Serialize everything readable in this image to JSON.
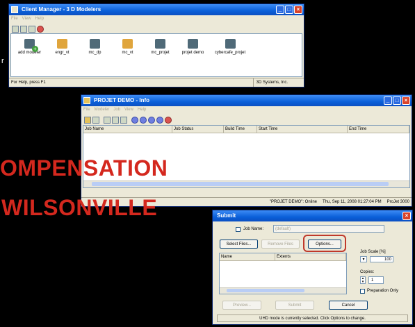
{
  "client_manager": {
    "title": "Client Manager - 3 D Modelers",
    "menu": [
      "File",
      "View",
      "Help"
    ],
    "icons": [
      "add modeler",
      "engr_vt",
      "mc_dp",
      "mc_vt",
      "mc_projet",
      "projet demo",
      "cybercafe_projet"
    ],
    "status_left": "For Help, press F1",
    "status_right": "3D Systems, Inc."
  },
  "projet_info": {
    "title": "PROJET DEMO - Info",
    "menu": [
      "File",
      "Modeler",
      "Job",
      "View",
      "Help"
    ],
    "columns": [
      "Job Name",
      "Job Status",
      "Build Time",
      "Start Time",
      "End Time"
    ],
    "status_left": "\"PROJET DEMO\": Online",
    "status_mid": "Thu, Sep 11, 2008  01:27:04 PM",
    "status_right": "ProJet 3000"
  },
  "overlay": {
    "line1": "OMPENSATION",
    "line2": "WILSONVILLE",
    "stray_left": "r",
    "stray_mid": "P"
  },
  "submit": {
    "title": "Submit",
    "job_name_label": "Job Name:",
    "job_name_value": "(default)",
    "select_files": "Select Files...",
    "remove_files": "Remove Files",
    "options": "Options...",
    "col_name": "Name",
    "col_extents": "Extents",
    "job_scale_label": "Job Scale [%]",
    "job_scale_value": "100",
    "copies_label": "Copies:",
    "copies_value": "1",
    "preparation_only": "Preparation Only",
    "preview": "Preview...",
    "submit_btn": "Submit",
    "cancel": "Cancel",
    "status_text": "UHD mode is currently selected. Click Options to change."
  },
  "colors": {
    "overlay_red": "#d4281e",
    "highlight_red": "#c0392b",
    "titlebar_blue": "#0a5fd9"
  }
}
